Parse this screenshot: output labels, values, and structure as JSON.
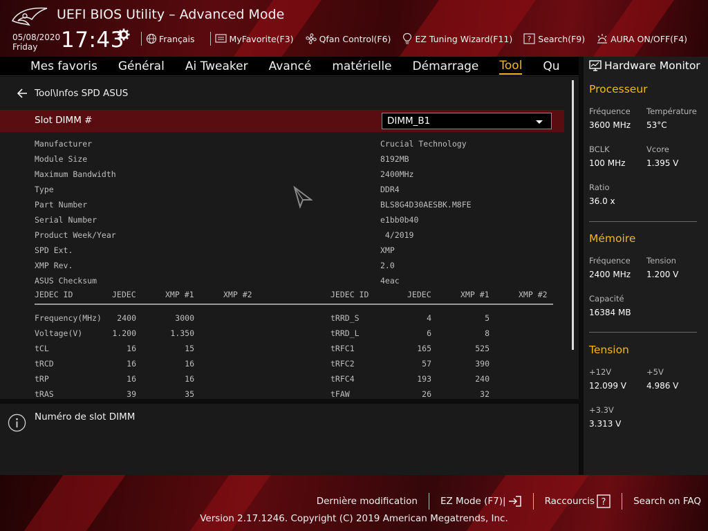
{
  "header": {
    "title": "UEFI BIOS Utility – Advanced Mode",
    "date": "05/08/2020",
    "day": "Friday",
    "time": "17:43",
    "toolbar": [
      {
        "label": "Français",
        "icon": "globe-icon"
      },
      {
        "label": "MyFavorite(F3)",
        "icon": "favorite-icon"
      },
      {
        "label": "Qfan Control(F6)",
        "icon": "fan-icon"
      },
      {
        "label": "EZ Tuning Wizard(F11)",
        "icon": "lightbulb-icon"
      },
      {
        "label": "Search(F9)",
        "icon": "question-box-icon"
      },
      {
        "label": "AURA ON/OFF(F4)",
        "icon": "aura-icon"
      }
    ]
  },
  "tabs": [
    {
      "label": "Mes favoris",
      "active": false
    },
    {
      "label": "Général",
      "active": false
    },
    {
      "label": "Ai Tweaker",
      "active": false
    },
    {
      "label": "Avancé",
      "active": false
    },
    {
      "label": "matérielle",
      "active": false
    },
    {
      "label": "Démarrage",
      "active": false
    },
    {
      "label": "Tool",
      "active": true
    },
    {
      "label": "Qu",
      "active": false
    }
  ],
  "breadcrumb": "Tool\\Infos SPD ASUS",
  "slot": {
    "label": "Slot DIMM #",
    "value": "DIMM_B1"
  },
  "info_rows": [
    {
      "key": "Manufacturer",
      "value": "Crucial Technology"
    },
    {
      "key": "Module Size",
      "value": "8192MB"
    },
    {
      "key": "Maximum Bandwidth",
      "value": "2400MHz"
    },
    {
      "key": "Type",
      "value": "DDR4"
    },
    {
      "key": "Part Number",
      "value": "BLS8G4D30AESBK.M8FE"
    },
    {
      "key": "Serial Number",
      "value": "e1bb0b40"
    },
    {
      "key": "Product Week/Year",
      "value": " 4/2019"
    },
    {
      "key": "SPD Ext.",
      "value": "XMP"
    },
    {
      "key": "XMP Rev.",
      "value": "2.0"
    },
    {
      "key": "ASUS Checksum",
      "value": "4eac"
    }
  ],
  "timing_headers": [
    "JEDEC ID",
    "JEDEC",
    "XMP #1",
    "XMP #2"
  ],
  "timing_left": [
    {
      "name": "Frequency(MHz)",
      "jedec": "2400",
      "xmp1": "3000",
      "xmp2": ""
    },
    {
      "name": "Voltage(V)",
      "jedec": "1.200",
      "xmp1": "1.350",
      "xmp2": ""
    },
    {
      "name": "tCL",
      "jedec": "16",
      "xmp1": "15",
      "xmp2": ""
    },
    {
      "name": "tRCD",
      "jedec": "16",
      "xmp1": "16",
      "xmp2": ""
    },
    {
      "name": "tRP",
      "jedec": "16",
      "xmp1": "16",
      "xmp2": ""
    },
    {
      "name": "tRAS",
      "jedec": "39",
      "xmp1": "35",
      "xmp2": ""
    }
  ],
  "timing_right": [
    {
      "name": "tRRD_S",
      "jedec": "4",
      "xmp1": "5",
      "xmp2": ""
    },
    {
      "name": "tRRD_L",
      "jedec": "6",
      "xmp1": "8",
      "xmp2": ""
    },
    {
      "name": "tRFC1",
      "jedec": "165",
      "xmp1": "525",
      "xmp2": ""
    },
    {
      "name": "tRFC2",
      "jedec": "57",
      "xmp1": "390",
      "xmp2": ""
    },
    {
      "name": "tRFC4",
      "jedec": "193",
      "xmp1": "240",
      "xmp2": ""
    },
    {
      "name": "tFAW",
      "jedec": "26",
      "xmp1": "32",
      "xmp2": ""
    }
  ],
  "help_text": "Numéro de slot DIMM",
  "hw_monitor": {
    "title": "Hardware Monitor",
    "processeur": {
      "title": "Processeur",
      "freq_label": "Fréquence",
      "freq_value": "3600 MHz",
      "temp_label": "Température",
      "temp_value": "53°C",
      "bclk_label": "BCLK",
      "bclk_value": "100 MHz",
      "vcore_label": "Vcore",
      "vcore_value": "1.395 V",
      "ratio_label": "Ratio",
      "ratio_value": "36.0 x"
    },
    "memoire": {
      "title": "Mémoire",
      "freq_label": "Fréquence",
      "freq_value": "2400 MHz",
      "tension_label": "Tension",
      "tension_value": "1.200 V",
      "cap_label": "Capacité",
      "cap_value": "16384 MB"
    },
    "tension": {
      "title": "Tension",
      "v12_label": "+12V",
      "v12_value": "12.099 V",
      "v5_label": "+5V",
      "v5_value": "4.986 V",
      "v33_label": "+3.3V",
      "v33_value": "3.313 V"
    }
  },
  "footer": {
    "last_mod": "Dernière modification",
    "ez_mode": "EZ Mode (F7)|",
    "shortcuts": "Raccourcis",
    "faq": "Search on FAQ",
    "version": "Version 2.17.1246. Copyright (C) 2019 American Megatrends, Inc."
  },
  "colors": {
    "accent": "#f2b81c",
    "selected_row": "#5a0d10",
    "header_red": "#6b0c12"
  }
}
